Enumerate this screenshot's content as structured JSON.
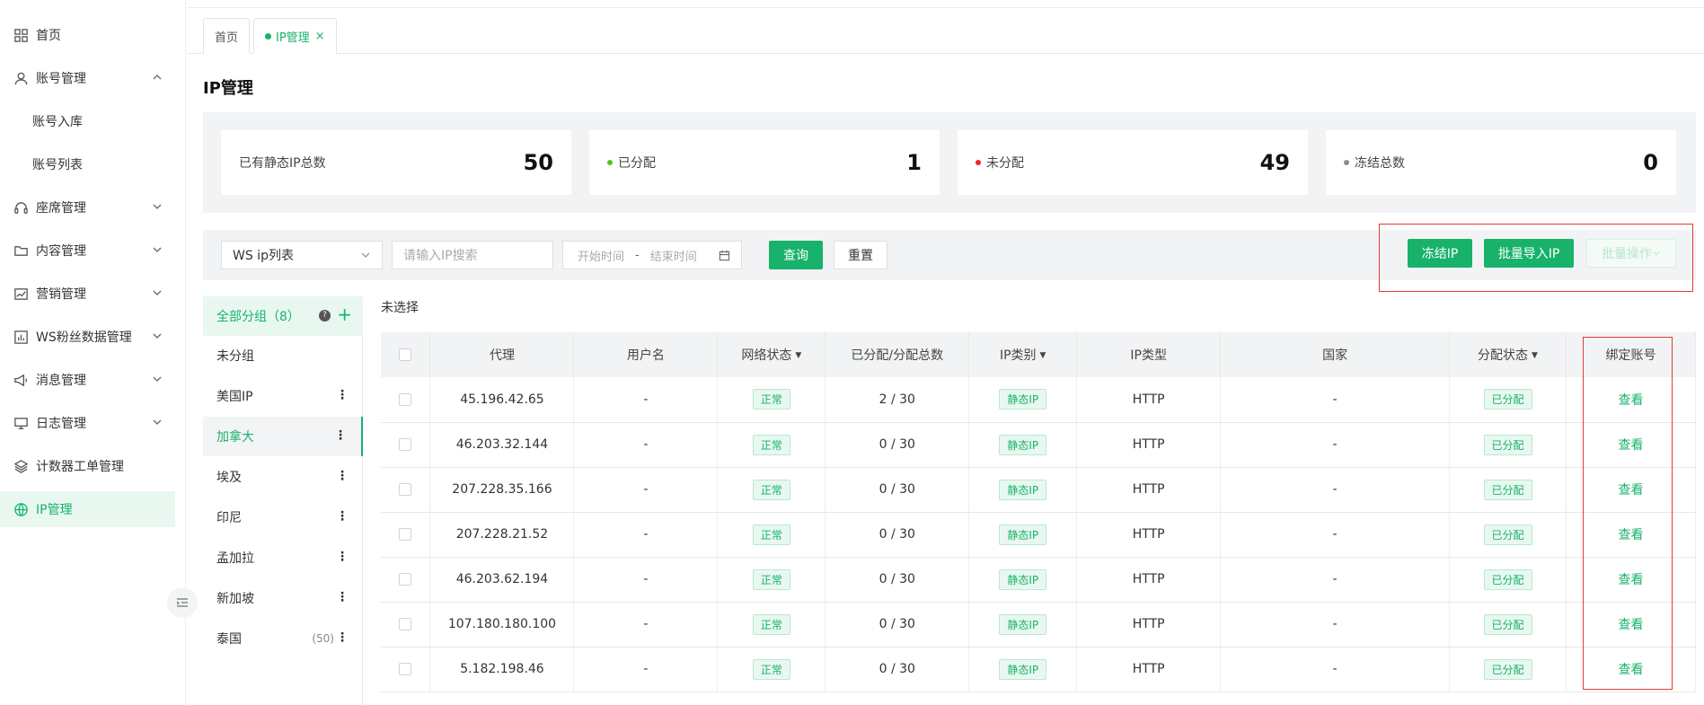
{
  "sidebar": {
    "items": [
      {
        "label": "首页",
        "icon": "grid-icon"
      },
      {
        "label": "账号管理",
        "icon": "user-icon",
        "expanded": true
      },
      {
        "label": "账号入库"
      },
      {
        "label": "账号列表"
      },
      {
        "label": "座席管理",
        "icon": "headset-icon"
      },
      {
        "label": "内容管理",
        "icon": "folder-icon"
      },
      {
        "label": "营销管理",
        "icon": "chart-line-icon"
      },
      {
        "label": "WS粉丝数据管理",
        "icon": "bar-chart-icon"
      },
      {
        "label": "消息管理",
        "icon": "megaphone-icon"
      },
      {
        "label": "日志管理",
        "icon": "monitor-icon"
      },
      {
        "label": "计数器工单管理",
        "icon": "layers-icon"
      },
      {
        "label": "IP管理",
        "icon": "globe-icon",
        "active": true
      }
    ]
  },
  "tabs": [
    {
      "label": "首页"
    },
    {
      "label": "IP管理",
      "active": true
    }
  ],
  "page_title": "IP管理",
  "stats": [
    {
      "label": "已有静态IP总数",
      "value": "50"
    },
    {
      "label": "已分配",
      "value": "1",
      "dot_color": "#52c41a"
    },
    {
      "label": "未分配",
      "value": "49",
      "dot_color": "#f5222d"
    },
    {
      "label": "冻结总数",
      "value": "0",
      "dot_color": "#8c8c8c"
    }
  ],
  "filter": {
    "list_select": "WS ip列表",
    "search_placeholder": "请输入IP搜索",
    "start_placeholder": "开始时间",
    "range_sep": "-",
    "end_placeholder": "结束时间",
    "query_label": "查询",
    "reset_label": "重置",
    "freeze_label": "冻结IP",
    "import_label": "批量导入IP",
    "batch_label": "批量操作"
  },
  "groups": {
    "all_label": "全部分组",
    "all_count": "（8）",
    "items": [
      {
        "label": "未分组"
      },
      {
        "label": "美国IP"
      },
      {
        "label": "加拿大",
        "selected": true
      },
      {
        "label": "埃及"
      },
      {
        "label": "印尼"
      },
      {
        "label": "孟加拉"
      },
      {
        "label": "新加坡"
      },
      {
        "label": "泰国",
        "count": "(50)"
      }
    ]
  },
  "selection_label": "未选择",
  "table": {
    "headers": [
      "代理",
      "用户名",
      "网络状态",
      "已分配/分配总数",
      "IP类别",
      "IP类型",
      "国家",
      "分配状态",
      "绑定账号"
    ],
    "rows": [
      {
        "proxy": "45.196.42.65",
        "user": "-",
        "net": "正常",
        "alloc": "2 / 30",
        "cat": "静态IP",
        "type": "HTTP",
        "country": "-",
        "status": "已分配",
        "action": "查看"
      },
      {
        "proxy": "46.203.32.144",
        "user": "-",
        "net": "正常",
        "alloc": "0 / 30",
        "cat": "静态IP",
        "type": "HTTP",
        "country": "-",
        "status": "已分配",
        "action": "查看"
      },
      {
        "proxy": "207.228.35.166",
        "user": "-",
        "net": "正常",
        "alloc": "0 / 30",
        "cat": "静态IP",
        "type": "HTTP",
        "country": "-",
        "status": "已分配",
        "action": "查看"
      },
      {
        "proxy": "207.228.21.52",
        "user": "-",
        "net": "正常",
        "alloc": "0 / 30",
        "cat": "静态IP",
        "type": "HTTP",
        "country": "-",
        "status": "已分配",
        "action": "查看"
      },
      {
        "proxy": "46.203.62.194",
        "user": "-",
        "net": "正常",
        "alloc": "0 / 30",
        "cat": "静态IP",
        "type": "HTTP",
        "country": "-",
        "status": "已分配",
        "action": "查看"
      },
      {
        "proxy": "107.180.180.100",
        "user": "-",
        "net": "正常",
        "alloc": "0 / 30",
        "cat": "静态IP",
        "type": "HTTP",
        "country": "-",
        "status": "已分配",
        "action": "查看"
      },
      {
        "proxy": "5.182.198.46",
        "user": "-",
        "net": "正常",
        "alloc": "0 / 30",
        "cat": "静态IP",
        "type": "HTTP",
        "country": "-",
        "status": "已分配",
        "action": "查看"
      }
    ]
  },
  "colors": {
    "accent": "#18b26b",
    "annotation": "#e53935"
  }
}
